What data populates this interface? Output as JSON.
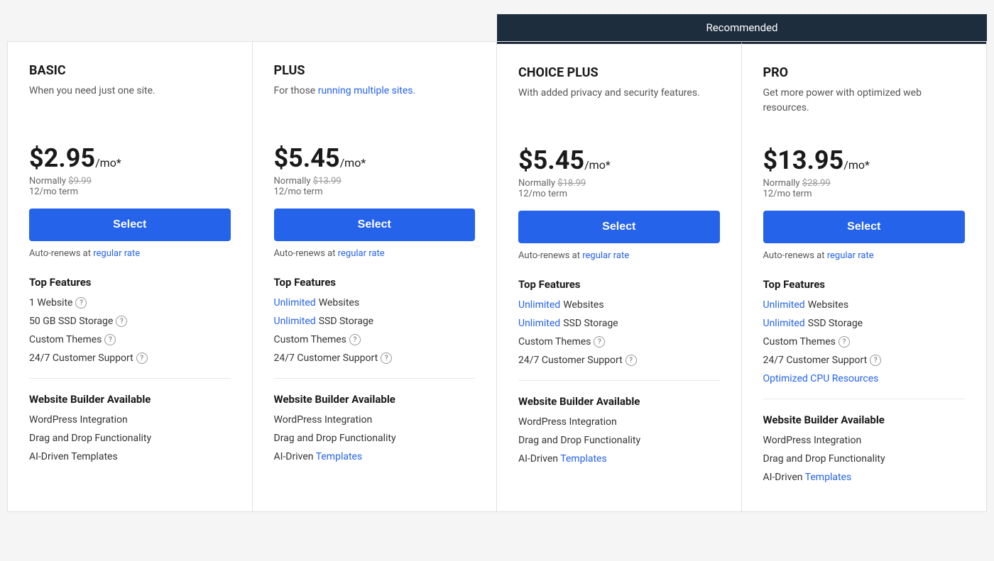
{
  "banner": {
    "text": "Recommended"
  },
  "plans": [
    {
      "id": "basic",
      "name": "BASIC",
      "desc_parts": [
        "When you need just one site."
      ],
      "desc_has_link": false,
      "price": "$2.95",
      "per_mo": "/mo*",
      "normally_label": "Normally",
      "normally_price": "$9.99",
      "term": "12/mo term",
      "select_label": "Select",
      "auto_renew_text": "Auto-renews at ",
      "auto_renew_link": "regular rate",
      "features_title": "Top Features",
      "features": [
        {
          "text": "1 Website",
          "has_info": true,
          "link_word": ""
        },
        {
          "text": "50 GB SSD Storage",
          "has_info": true,
          "link_word": ""
        },
        {
          "text": "Custom Themes",
          "has_info": true,
          "link_word": ""
        },
        {
          "text": "24/7 Customer Support",
          "has_info": true,
          "link_word": ""
        }
      ],
      "builder_title": "Website Builder Available",
      "builder_items": [
        {
          "text": "WordPress Integration",
          "link_word": ""
        },
        {
          "text": "Drag and Drop Functionality",
          "link_word": ""
        },
        {
          "text": "AI-Driven Templates",
          "link_word": ""
        }
      ],
      "recommended": false
    },
    {
      "id": "plus",
      "name": "PLUS",
      "desc_parts": [
        "For those ",
        "running multiple sites."
      ],
      "desc_has_link": true,
      "desc_link_text": "running multiple sites.",
      "price": "$5.45",
      "per_mo": "/mo*",
      "normally_label": "Normally",
      "normally_price": "$13.99",
      "term": "12/mo term",
      "select_label": "Select",
      "auto_renew_text": "Auto-renews at ",
      "auto_renew_link": "regular rate",
      "features_title": "Top Features",
      "features": [
        {
          "text": "Unlimited Websites",
          "has_info": false,
          "link_word": "Unlimited"
        },
        {
          "text": "Unlimited SSD Storage",
          "has_info": false,
          "link_word": "Unlimited"
        },
        {
          "text": "Custom Themes",
          "has_info": true,
          "link_word": ""
        },
        {
          "text": "24/7 Customer Support",
          "has_info": true,
          "link_word": ""
        }
      ],
      "builder_title": "Website Builder Available",
      "builder_items": [
        {
          "text": "WordPress Integration",
          "link_word": ""
        },
        {
          "text": "Drag and Drop Functionality",
          "link_word": ""
        },
        {
          "text": "AI-Driven Templates",
          "link_word": ""
        }
      ],
      "recommended": false
    },
    {
      "id": "choice-plus",
      "name": "CHOICE PLUS",
      "desc_parts": [
        "With added privacy and security features."
      ],
      "desc_has_link": false,
      "price": "$5.45",
      "per_mo": "/mo*",
      "normally_label": "Normally",
      "normally_price": "$18.99",
      "term": "12/mo term",
      "select_label": "Select",
      "auto_renew_text": "Auto-renews at ",
      "auto_renew_link": "regular rate",
      "features_title": "Top Features",
      "features": [
        {
          "text": "Unlimited Websites",
          "has_info": false,
          "link_word": "Unlimited"
        },
        {
          "text": "Unlimited SSD Storage",
          "has_info": false,
          "link_word": "Unlimited"
        },
        {
          "text": "Custom Themes",
          "has_info": true,
          "link_word": ""
        },
        {
          "text": "24/7 Customer Support",
          "has_info": true,
          "link_word": ""
        }
      ],
      "builder_title": "Website Builder Available",
      "builder_items": [
        {
          "text": "WordPress Integration",
          "link_word": ""
        },
        {
          "text": "Drag and Drop Functionality",
          "link_word": ""
        },
        {
          "text": "AI-Driven Templates",
          "link_word": ""
        }
      ],
      "recommended": true
    },
    {
      "id": "pro",
      "name": "PRO",
      "desc_parts": [
        "Get more power with optimized web resources."
      ],
      "desc_has_link": false,
      "price": "$13.95",
      "per_mo": "/mo*",
      "normally_label": "Normally",
      "normally_price": "$28.99",
      "term": "12/mo term",
      "select_label": "Select",
      "auto_renew_text": "Auto-renews at ",
      "auto_renew_link": "regular rate",
      "features_title": "Top Features",
      "features": [
        {
          "text": "Unlimited Websites",
          "has_info": false,
          "link_word": "Unlimited"
        },
        {
          "text": "Unlimited SSD Storage",
          "has_info": false,
          "link_word": "Unlimited"
        },
        {
          "text": "Custom Themes",
          "has_info": true,
          "link_word": ""
        },
        {
          "text": "24/7 Customer Support",
          "has_info": true,
          "link_word": ""
        },
        {
          "text": "Optimized CPU Resources",
          "has_info": false,
          "link_word": "Optimized CPU Resources",
          "is_extra_link": true
        }
      ],
      "builder_title": "Website Builder Available",
      "builder_items": [
        {
          "text": "WordPress Integration",
          "link_word": ""
        },
        {
          "text": "Drag and Drop Functionality",
          "link_word": ""
        },
        {
          "text": "AI-Driven Templates",
          "link_word": ""
        }
      ],
      "recommended": true
    }
  ]
}
